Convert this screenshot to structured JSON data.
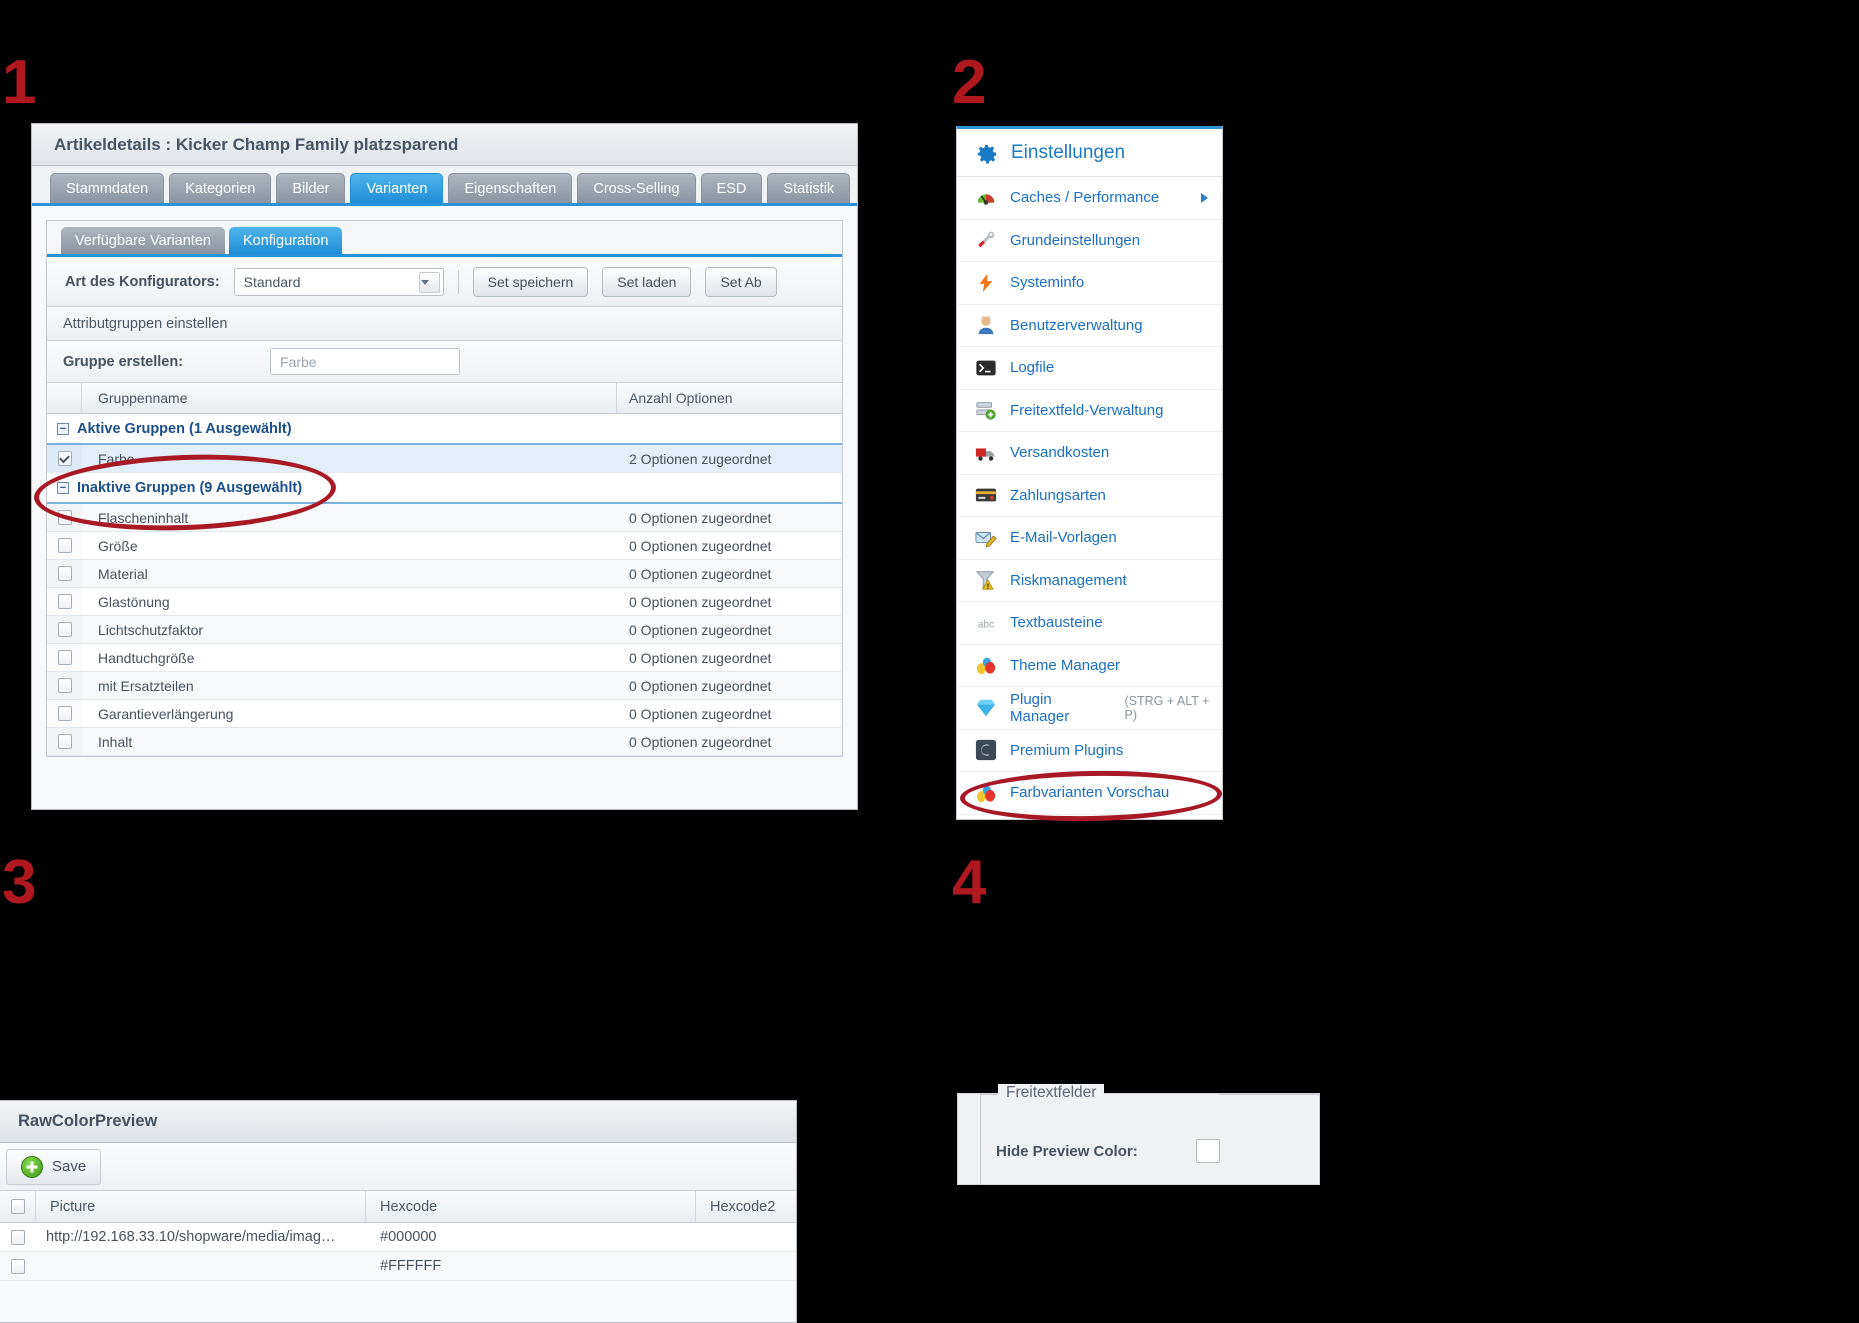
{
  "steps": {
    "one": "1",
    "two": "2",
    "three": "3",
    "four": "4"
  },
  "colors": {
    "accent": "#2a92d8",
    "link": "#1a6fc4",
    "annotation": "#a81825",
    "header_text": "#46525f"
  },
  "panel1": {
    "title": "Artikeldetails : Kicker Champ Family platzsparend",
    "tabs": [
      {
        "label": "Stammdaten",
        "active": false
      },
      {
        "label": "Kategorien",
        "active": false
      },
      {
        "label": "Bilder",
        "active": false
      },
      {
        "label": "Varianten",
        "active": true
      },
      {
        "label": "Eigenschaften",
        "active": false
      },
      {
        "label": "Cross-Selling",
        "active": false
      },
      {
        "label": "ESD",
        "active": false
      },
      {
        "label": "Statistik",
        "active": false
      }
    ],
    "subtabs": [
      {
        "label": "Verfügbare Varianten",
        "active": false
      },
      {
        "label": "Konfiguration",
        "active": true
      }
    ],
    "toolbar": {
      "konfigurator_label": "Art des Konfigurators:",
      "konfigurator_value": "Standard",
      "btn_set_speichern": "Set speichern",
      "btn_set_laden": "Set laden",
      "btn_set_ab": "Set Ab"
    },
    "section_header": "Attributgruppen einstellen",
    "create_group": {
      "label": "Gruppe erstellen:",
      "placeholder": "Farbe"
    },
    "grid_headers": {
      "gruppenname": "Gruppenname",
      "anzahl_optionen": "Anzahl Optionen"
    },
    "groups": [
      {
        "header": "Aktive Gruppen (1 Ausgewählt)",
        "collapse_glyph": "−",
        "rows": [
          {
            "name": "Farbe",
            "options": "2 Optionen zugeordnet",
            "checked": true,
            "selected": true
          }
        ]
      },
      {
        "header": "Inaktive Gruppen (9 Ausgewählt)",
        "collapse_glyph": "−",
        "rows": [
          {
            "name": "Flascheninhalt",
            "options": "0 Optionen zugeordnet",
            "checked": false,
            "selected": false
          },
          {
            "name": "Größe",
            "options": "0 Optionen zugeordnet",
            "checked": false,
            "selected": false
          },
          {
            "name": "Material",
            "options": "0 Optionen zugeordnet",
            "checked": false,
            "selected": false
          },
          {
            "name": "Glastönung",
            "options": "0 Optionen zugeordnet",
            "checked": false,
            "selected": false
          },
          {
            "name": "Lichtschutzfaktor",
            "options": "0 Optionen zugeordnet",
            "checked": false,
            "selected": false
          },
          {
            "name": "Handtuchgröße",
            "options": "0 Optionen zugeordnet",
            "checked": false,
            "selected": false
          },
          {
            "name": "mit Ersatzteilen",
            "options": "0 Optionen zugeordnet",
            "checked": false,
            "selected": false
          },
          {
            "name": "Garantieverlängerung",
            "options": "0 Optionen zugeordnet",
            "checked": false,
            "selected": false
          },
          {
            "name": "Inhalt",
            "options": "0 Optionen zugeordnet",
            "checked": false,
            "selected": false
          }
        ]
      }
    ]
  },
  "panel2": {
    "title": "Einstellungen",
    "items": [
      {
        "label": "Caches / Performance",
        "icon": "gauge-icon",
        "has_submenu": true,
        "hint": ""
      },
      {
        "label": "Grundeinstellungen",
        "icon": "screwdriver-wrench-icon",
        "has_submenu": false,
        "hint": ""
      },
      {
        "label": "Systeminfo",
        "icon": "lightning-bolt-icon",
        "has_submenu": false,
        "hint": ""
      },
      {
        "label": "Benutzerverwaltung",
        "icon": "user-icon",
        "has_submenu": false,
        "hint": ""
      },
      {
        "label": "Logfile",
        "icon": "terminal-icon",
        "has_submenu": false,
        "hint": ""
      },
      {
        "label": "Freitextfeld-Verwaltung",
        "icon": "form-add-icon",
        "has_submenu": false,
        "hint": ""
      },
      {
        "label": "Versandkosten",
        "icon": "truck-icon",
        "has_submenu": false,
        "hint": ""
      },
      {
        "label": "Zahlungsarten",
        "icon": "credit-card-icon",
        "has_submenu": false,
        "hint": ""
      },
      {
        "label": "E-Mail-Vorlagen",
        "icon": "mail-edit-icon",
        "has_submenu": false,
        "hint": ""
      },
      {
        "label": "Riskmanagement",
        "icon": "funnel-warning-icon",
        "has_submenu": false,
        "hint": ""
      },
      {
        "label": "Textbausteine",
        "icon": "abc-icon",
        "has_submenu": false,
        "hint": ""
      },
      {
        "label": "Theme Manager",
        "icon": "color-drops-icon",
        "has_submenu": false,
        "hint": ""
      },
      {
        "label": "Plugin Manager",
        "icon": "diamond-icon",
        "has_submenu": false,
        "hint": "(STRG + ALT + P)"
      },
      {
        "label": "Premium Plugins",
        "icon": "shopware-logo-icon",
        "has_submenu": false,
        "hint": ""
      },
      {
        "label": "Farbvarianten Vorschau",
        "icon": "color-drops-icon",
        "has_submenu": false,
        "hint": ""
      }
    ]
  },
  "panel3": {
    "title": "RawColorPreview",
    "save_label": "Save",
    "columns": [
      "Picture",
      "Hexcode",
      "Hexcode2"
    ],
    "rows": [
      {
        "picture": "http://192.168.33.10/shopware/media/imag…",
        "hexcode": "#000000",
        "hexcode2": ""
      },
      {
        "picture": "",
        "hexcode": "#FFFFFF",
        "hexcode2": ""
      }
    ]
  },
  "panel4": {
    "legend": "Freitextfelder",
    "hide_preview_label": "Hide Preview Color:"
  }
}
